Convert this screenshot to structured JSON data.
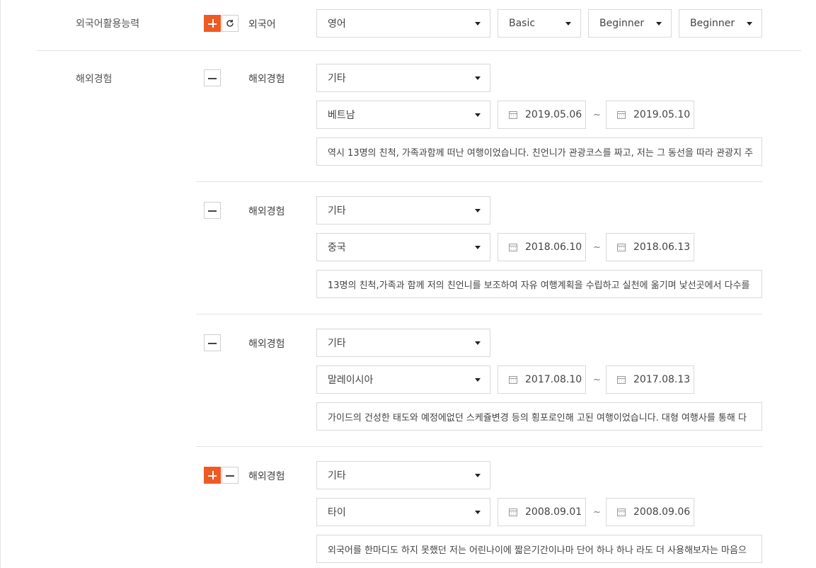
{
  "language": {
    "section_label": "외국어활용능력",
    "field_label": "외국어",
    "language_value": "영어",
    "level_1": "Basic",
    "level_2": "Beginner",
    "level_3": "Beginner"
  },
  "overseas": {
    "section_label": "해외경험",
    "entries": [
      {
        "label": "해외경험",
        "type": "기타",
        "country": "베트남",
        "start": "2019.05.06",
        "end": "2019.05.10",
        "description": "역시 13명의 친척, 가족과함께 떠난 여행이었습니다. 친언니가 관광코스를 짜고, 저는 그 동선을 따라 관광지 주"
      },
      {
        "label": "해외경험",
        "type": "기타",
        "country": "중국",
        "start": "2018.06.10",
        "end": "2018.06.13",
        "description": "13명의 친척,가족과 함께  저의 친언니를 보조하여 자유 여행계획을 수립하고 실천에 옮기며 낯선곳에서 다수를"
      },
      {
        "label": "해외경험",
        "type": "기타",
        "country": "말레이시아",
        "start": "2017.08.10",
        "end": "2017.08.13",
        "description": "가이드의 건성한 태도와 예정에없던 스케쥴변경 등의 횡포로인해 고된 여행이었습니다. 대형 여행사를 통해 다"
      },
      {
        "label": "해외경험",
        "type": "기타",
        "country": "타이",
        "start": "2008.09.01",
        "end": "2008.09.06",
        "description": "외국어를 한마디도 하지 못했던 저는 어린나이에 짧은기간이나마 단어 하나 하나 라도 더 사용해보자는 마음으"
      }
    ],
    "range_separator": "~"
  },
  "icons": {
    "add": "plus-icon",
    "remove": "minus-icon",
    "reset": "refresh-icon",
    "dropdown": "caret-down-icon",
    "date": "calendar-icon"
  },
  "colors": {
    "accent": "#ef5a24",
    "border": "#d9d9d9",
    "divider": "#e3e3e3",
    "text": "#444444"
  }
}
